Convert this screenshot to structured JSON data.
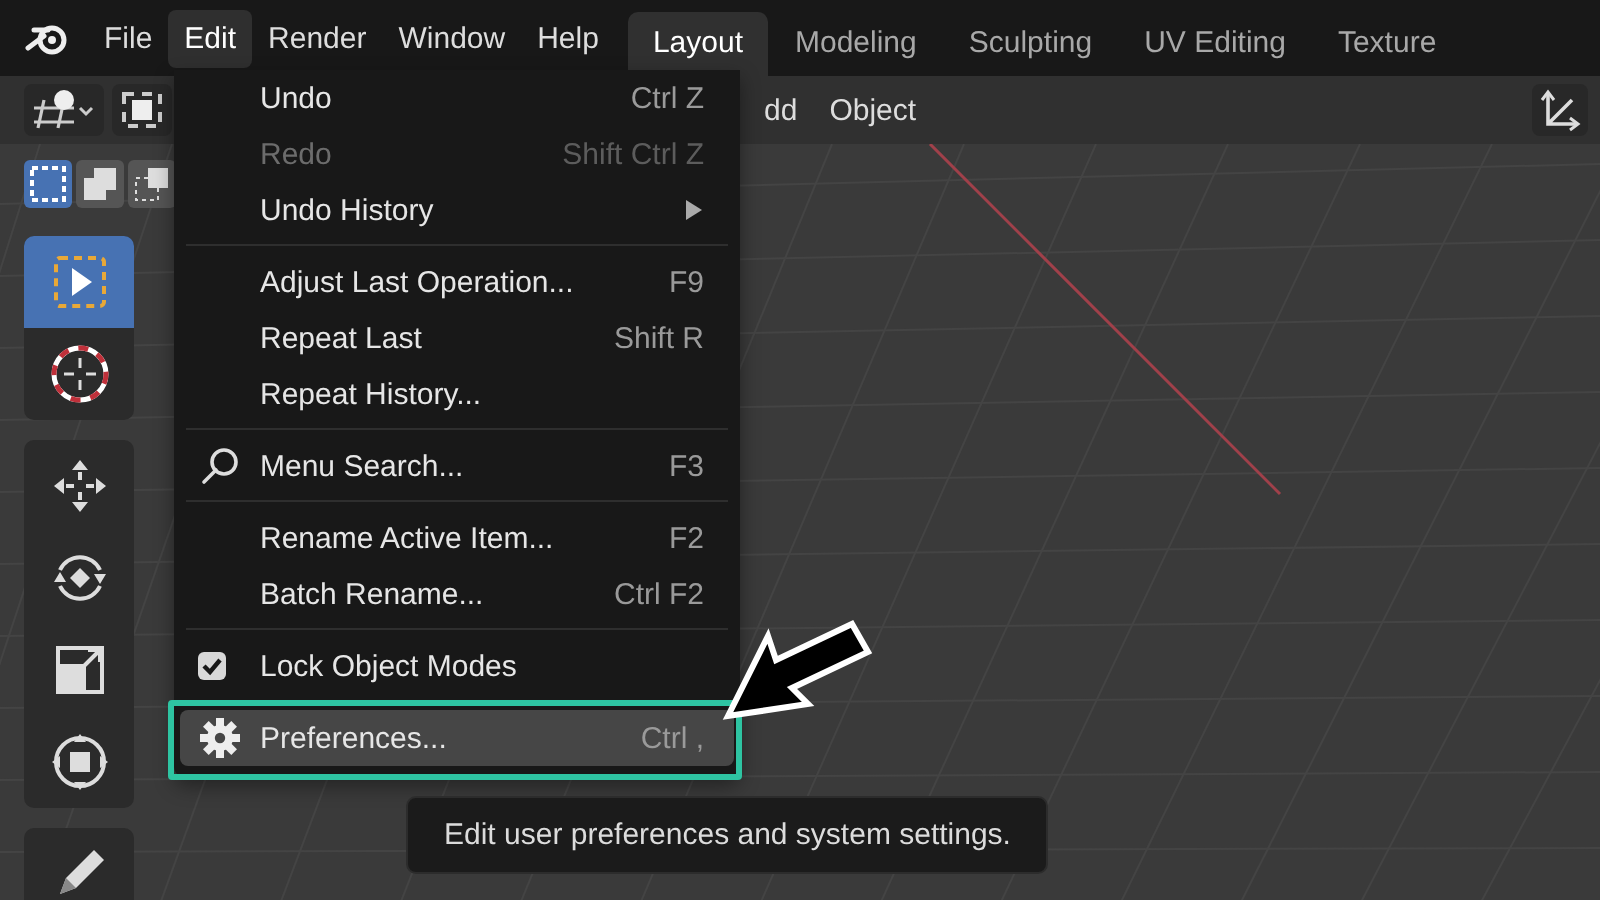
{
  "topbar": {
    "menus": [
      {
        "label": "File",
        "selected": false
      },
      {
        "label": "Edit",
        "selected": true
      },
      {
        "label": "Render",
        "selected": false
      },
      {
        "label": "Window",
        "selected": false
      },
      {
        "label": "Help",
        "selected": false
      }
    ],
    "workspaces": [
      {
        "label": "Layout",
        "selected": true
      },
      {
        "label": "Modeling",
        "selected": false
      },
      {
        "label": "Sculpting",
        "selected": false
      },
      {
        "label": "UV Editing",
        "selected": false
      },
      {
        "label": "Texture",
        "selected": false
      }
    ]
  },
  "header": {
    "menus": [
      "dd",
      "Object"
    ]
  },
  "toolbar": {
    "tools": [
      {
        "kind": "select",
        "selected": true
      },
      {
        "kind": "cursor",
        "selected": false
      },
      {
        "kind": "move",
        "selected": false
      },
      {
        "kind": "rotate",
        "selected": false
      },
      {
        "kind": "scale",
        "selected": false
      },
      {
        "kind": "transform",
        "selected": false
      },
      {
        "kind": "annotate",
        "selected": false
      }
    ]
  },
  "edit_menu": {
    "items": [
      {
        "kind": "item",
        "label": "Undo",
        "shortcut": "Ctrl Z",
        "disabled": false,
        "selected": false
      },
      {
        "kind": "item",
        "label": "Redo",
        "shortcut": "Shift Ctrl Z",
        "disabled": true,
        "selected": false
      },
      {
        "kind": "submenu",
        "label": "Undo History",
        "disabled": false,
        "selected": false
      },
      {
        "kind": "separator"
      },
      {
        "kind": "item",
        "label": "Adjust Last Operation...",
        "shortcut": "F9",
        "disabled": false,
        "selected": false
      },
      {
        "kind": "item",
        "label": "Repeat Last",
        "shortcut": "Shift R",
        "disabled": false,
        "selected": false
      },
      {
        "kind": "item",
        "label": "Repeat History...",
        "disabled": false,
        "selected": false
      },
      {
        "kind": "separator"
      },
      {
        "kind": "search",
        "label": "Menu Search...",
        "shortcut": "F3",
        "disabled": false,
        "selected": false
      },
      {
        "kind": "separator"
      },
      {
        "kind": "item",
        "label": "Rename Active Item...",
        "shortcut": "F2",
        "disabled": false,
        "selected": false
      },
      {
        "kind": "item",
        "label": "Batch Rename...",
        "shortcut": "Ctrl F2",
        "disabled": false,
        "selected": false
      },
      {
        "kind": "separator"
      },
      {
        "kind": "checkbox",
        "label": "Lock Object Modes",
        "checked": true,
        "disabled": false,
        "selected": false
      },
      {
        "kind": "separator"
      },
      {
        "kind": "gear",
        "label": "Preferences...",
        "shortcut": "Ctrl ,",
        "disabled": false,
        "selected": true
      }
    ]
  },
  "tooltip": {
    "text": "Edit user preferences and system settings."
  }
}
